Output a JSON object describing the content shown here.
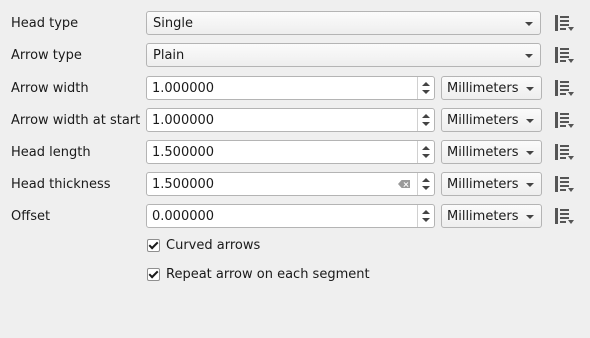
{
  "fields": [
    {
      "label": "Head type",
      "kind": "combo",
      "value": "Single"
    },
    {
      "label": "Arrow type",
      "kind": "combo",
      "value": "Plain"
    },
    {
      "label": "Arrow width",
      "kind": "spin",
      "value": "1.000000",
      "unit": "Millimeters"
    },
    {
      "label": "Arrow width at start",
      "kind": "spin",
      "value": "1.000000",
      "unit": "Millimeters"
    },
    {
      "label": "Head length",
      "kind": "spin",
      "value": "1.500000",
      "unit": "Millimeters"
    },
    {
      "label": "Head thickness",
      "kind": "spin",
      "value": "1.500000",
      "unit": "Millimeters",
      "clear_button": true
    },
    {
      "label": "Offset",
      "kind": "spin",
      "value": "0.000000",
      "unit": "Millimeters"
    }
  ],
  "checkboxes": [
    {
      "label": "Curved arrows",
      "checked": true
    },
    {
      "label": "Repeat arrow on each segment",
      "checked": true
    }
  ],
  "icons": {
    "data_defined": "data-defined-override-icon",
    "clear": "clear-icon",
    "dropdown": "chevron-down-icon"
  }
}
